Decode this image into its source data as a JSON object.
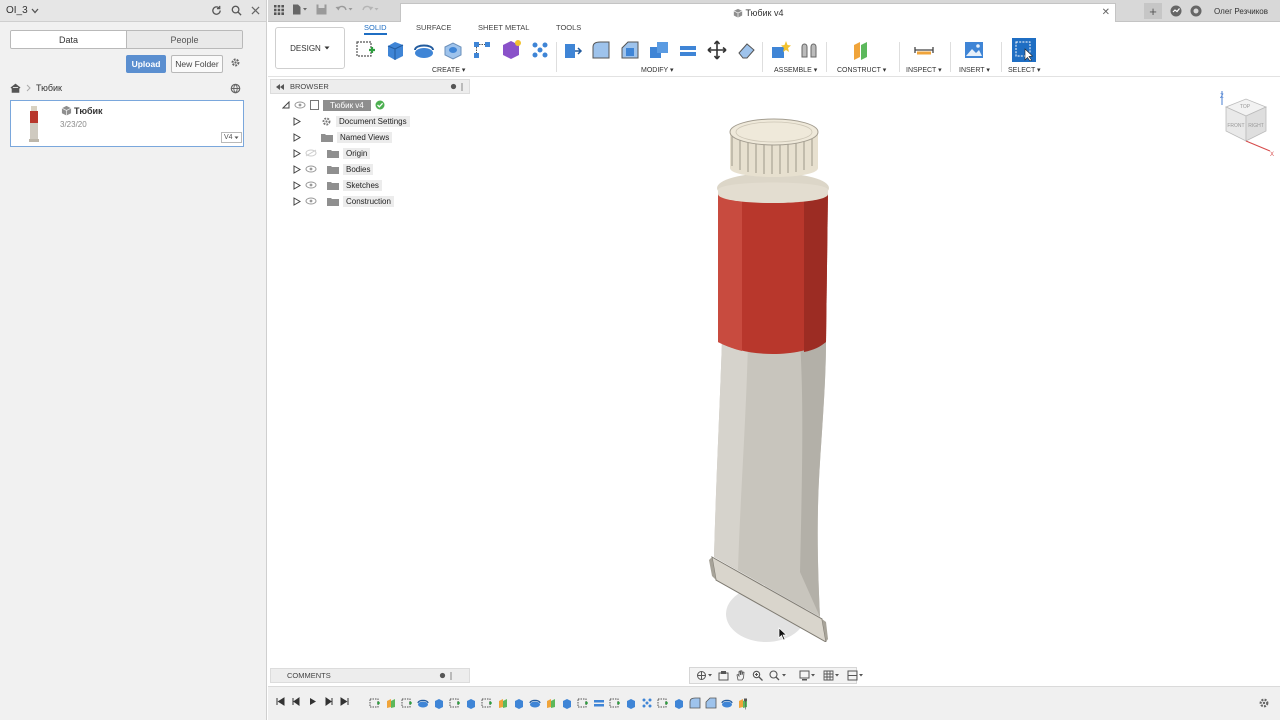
{
  "left_panel": {
    "project_name": "OI_3",
    "tabs": {
      "data": "Data",
      "people": "People"
    },
    "upload_label": "Upload",
    "new_folder_label": "New Folder",
    "breadcrumb": "Тюбик",
    "file": {
      "name": "Тюбик",
      "date": "3/23/20",
      "version": "V4"
    }
  },
  "document": {
    "title": "Тюбик v4"
  },
  "user": {
    "name": "Олег Резчиков"
  },
  "toolbar": {
    "workspace": "DESIGN",
    "tabs": [
      "SOLID",
      "SURFACE",
      "SHEET METAL",
      "TOOLS"
    ],
    "groups": [
      "CREATE",
      "MODIFY",
      "ASSEMBLE",
      "CONSTRUCT",
      "INSPECT",
      "INSERT",
      "SELECT"
    ]
  },
  "browser": {
    "title": "BROWSER",
    "root": "Тюбик v4",
    "items": [
      "Document Settings",
      "Named Views",
      "Origin",
      "Bodies",
      "Sketches",
      "Construction"
    ]
  },
  "comments": {
    "title": "COMMENTS"
  },
  "viewcube": {
    "top": "TOP",
    "front": "FRONT",
    "right": "RIGHT",
    "z": "Z",
    "x": "X"
  },
  "colors": {
    "accent": "#1f6ec3",
    "upload": "#5b8fd0",
    "tube_red": "#b8372c",
    "tube_body": "#c8c5bd",
    "cap": "#e7e0cf"
  },
  "timeline": {
    "feature_count": 24
  }
}
